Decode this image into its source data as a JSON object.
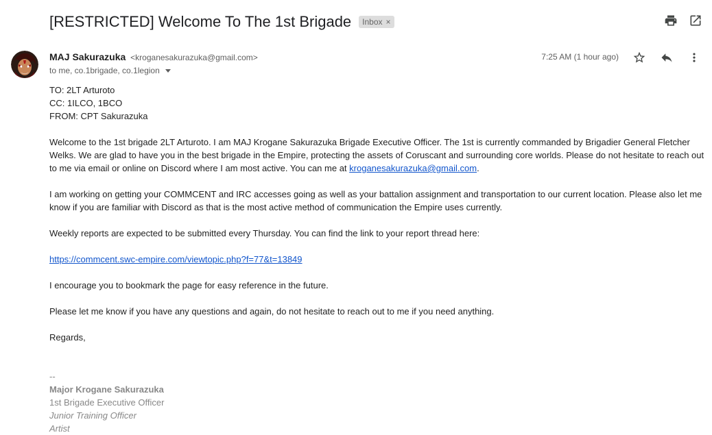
{
  "email": {
    "subject": "[RESTRICTED] Welcome To The 1st Brigade",
    "label": "Inbox",
    "label_remove": "×",
    "sender_name": "MAJ Sakurazuka",
    "sender_email": "<kroganesakurazuka@gmail.com>",
    "recipients": "to me, co.1brigade, co.1legion",
    "date": "7:25 AM (1 hour ago)"
  },
  "toolbar_icons": [
    "print-icon",
    "open-in-new-window-icon",
    "star-icon",
    "reply-icon",
    "more-vert-icon"
  ],
  "body": {
    "header_to": "TO: 2LT Arturoto",
    "header_cc": "CC: 1ILCO, 1BCO",
    "header_from": "FROM: CPT Sakurazuka",
    "para1": "Welcome to the 1st brigade 2LT Arturoto. I am MAJ Krogane Sakurazuka Brigade Executive Officer. The 1st is currently commanded by Brigadier General Fletcher Welks.  We are glad to have you in the best brigade in the Empire, protecting the assets of Coruscant and surrounding core worlds.  Please do not hesitate to reach out to me via email or online on Discord where I am most active.  You can me at ",
    "para1_link": "kroganesakurazuka@gmail.com",
    "para1_end": ".",
    "para2": "I am working on getting your COMMCENT and IRC accesses going as well as your battalion assignment and transportation to our current location.  Please also let me know if you are familiar with Discord as that is the most active method of communication the Empire uses currently.",
    "para3": "Weekly reports are expected to be submitted every Thursday.  You can find the link to your report thread here:",
    "report_link": "https://commcent.swc-empire.com/viewtopic.php?f=77&t=13849",
    "para4": "I encourage you to bookmark the page for easy reference in the future.",
    "para5": "Please let me know if you have any questions and again, do not hesitate to reach out to me if you need anything.",
    "closing": "Regards,"
  },
  "signature": {
    "dashes": "--",
    "name": "Major Krogane Sakurazuka",
    "title": "1st Brigade Executive Officer",
    "role1": "Junior Training Officer",
    "role2": "Artist"
  },
  "colors": {
    "link": "#1155cc",
    "signature": "#888888",
    "label_bg": "#dddddd"
  }
}
